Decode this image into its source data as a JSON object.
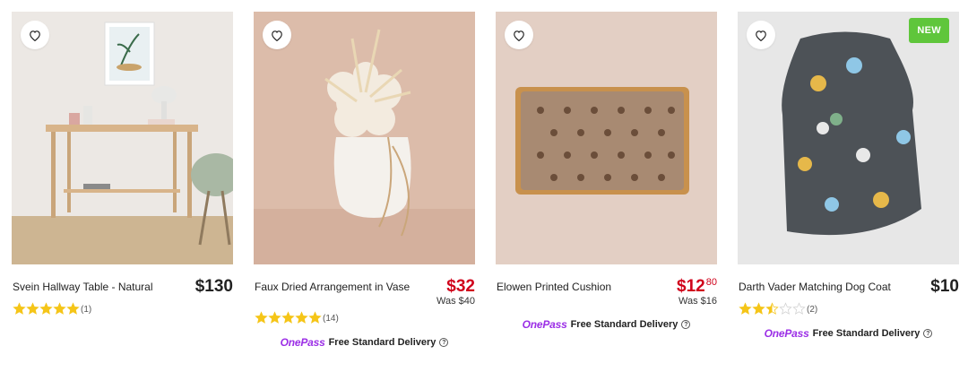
{
  "products": [
    {
      "title": "Svein Hallway Table - Natural",
      "price": "$130",
      "rating": 5,
      "reviews": "(1)"
    },
    {
      "title": "Faux Dried Arrangement in Vase",
      "price": "$32",
      "was": "Was $40",
      "rating": 5,
      "reviews": "(14)",
      "delivery_brand": "OnePass",
      "delivery_text": "Free Standard Delivery"
    },
    {
      "title": "Elowen Printed Cushion",
      "price_dollars": "$12",
      "price_cents": "80",
      "was": "Was $16",
      "delivery_brand": "OnePass",
      "delivery_text": "Free Standard Delivery"
    },
    {
      "title": "Darth Vader Matching Dog Coat",
      "price": "$10",
      "badge": "NEW",
      "rating": 2.5,
      "reviews": "(2)",
      "delivery_brand": "OnePass",
      "delivery_text": "Free Standard Delivery"
    }
  ],
  "colors": {
    "sale_price": "#d0021b",
    "star": "#f5c518",
    "onepass": "#9b2ee6",
    "new_badge": "#5fc63b"
  }
}
